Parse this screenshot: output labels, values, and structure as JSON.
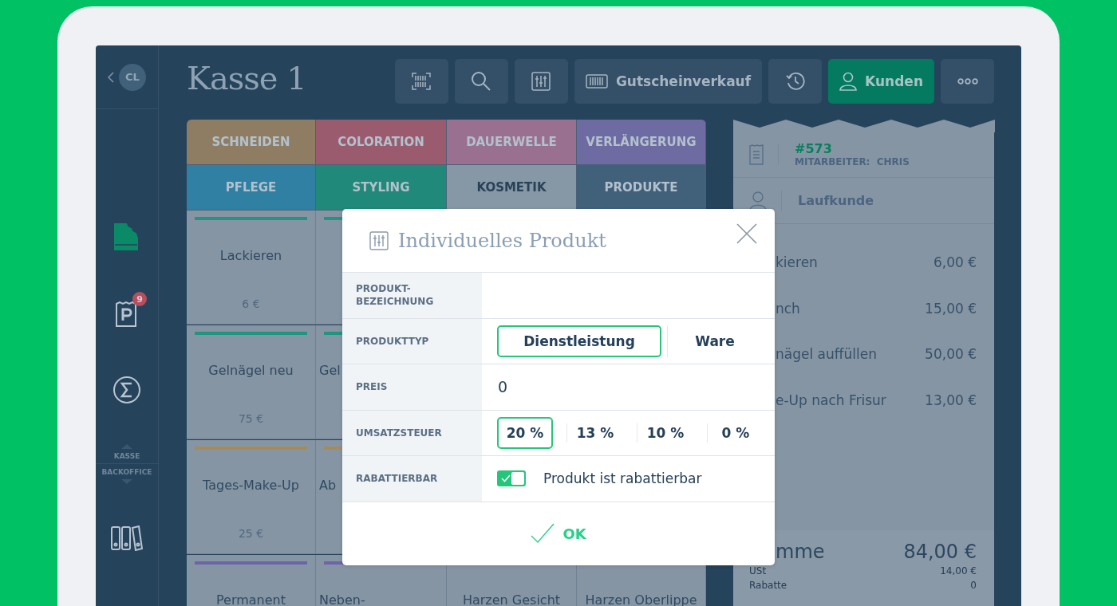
{
  "sidebar": {
    "avatar": "CL",
    "items": [
      {
        "kind": "register",
        "selected": true
      },
      {
        "kind": "parking",
        "badge": "9",
        "selected": false
      },
      {
        "kind": "sum",
        "selected": false
      }
    ],
    "mode_switch": {
      "upper": "KASSE",
      "lower": "BACKOFFICE"
    },
    "bottom_items": [
      {
        "kind": "binders",
        "selected": false
      }
    ]
  },
  "header": {
    "title": "Kasse 1"
  },
  "toolbar": [
    {
      "kind": "scan",
      "selected": false
    },
    {
      "kind": "search",
      "selected": false
    },
    {
      "kind": "custom",
      "selected": false
    },
    {
      "kind": "voucher",
      "label": "Gutscheinverkauf",
      "selected": false
    },
    {
      "kind": "history",
      "selected": false
    },
    {
      "kind": "customer",
      "label": "Kunden",
      "selected": true
    },
    {
      "kind": "more",
      "selected": false
    }
  ],
  "categories": [
    {
      "label": "SCHNEIDEN",
      "color": "#8e7d62",
      "selected": false
    },
    {
      "label": "COLORATION",
      "color": "#9a5b6e",
      "selected": false
    },
    {
      "label": "DAUERWELLE",
      "color": "#9a7090",
      "selected": false
    },
    {
      "label": "VERLÄNGERUNG",
      "color": "#6e6aa2",
      "selected": false
    },
    {
      "label": "PFLEGE",
      "color": "#2f80a2",
      "selected": false
    },
    {
      "label": "STYLING",
      "color": "#21897a",
      "selected": false
    },
    {
      "label": "KOSMETIK",
      "color": "#8697a6",
      "selected": true
    },
    {
      "label": "PRODUKTE",
      "color": "#41607a",
      "selected": false
    }
  ],
  "product_rows": [
    {
      "cells": [
        {
          "name": "Lackieren",
          "price": "6 €",
          "color": "#21957f"
        },
        {
          "color": "#21957f"
        }
      ]
    },
    {
      "cells": [
        {
          "name": "Gelnägel neu",
          "price": "75 €",
          "color": "#21957f"
        },
        {
          "name": "Gel",
          "color": "#21957f"
        }
      ]
    },
    {
      "cells": [
        {
          "name": "Tages-Make-Up",
          "price": "25 €",
          "color": "#a88a5a"
        },
        {
          "name": "Ab",
          "color": "#a88a5a"
        }
      ]
    },
    {
      "cells": [
        {
          "name": "Permanent",
          "color": "#6d65a8"
        },
        {
          "name": "Neben-",
          "color": "#6d65a8"
        },
        {
          "name": "Harzen Gesicht"
        },
        {
          "name": "Harzen Oberlippe"
        }
      ]
    }
  ],
  "receipt": {
    "number": "#573",
    "staff": "MITARBEITER:  CHRIS",
    "customer": "Laufkunde",
    "items": [
      {
        "name": "kieren",
        "price": "6,00 €"
      },
      {
        "name": "nch",
        "price": "15,00 €"
      },
      {
        "name": "nägel auffüllen",
        "price": "50,00 €"
      },
      {
        "name": "e-Up nach Frisur",
        "price": "13,00 €"
      }
    ],
    "total_label": "mme",
    "total": "84,00 €",
    "tax_label": "USt",
    "tax": "14,00 €",
    "discount_label": "Rabatte",
    "discount": "0"
  },
  "dialog": {
    "title": "Individuelles Produkt",
    "name_label": "PRODUKT-\nBEZEICHNUNG",
    "type_label": "PRODUKTTYP",
    "types": [
      {
        "label": "Dienstleistung",
        "selected": true
      },
      {
        "label": "Ware",
        "selected": false
      }
    ],
    "price_label": "PREIS",
    "price": "0",
    "tax_label": "UMSATZSTEUER",
    "taxes": [
      {
        "label": "20 %",
        "selected": true
      },
      {
        "label": "13 %",
        "selected": false
      },
      {
        "label": "10 %",
        "selected": false
      },
      {
        "label": "0 %",
        "selected": false
      }
    ],
    "discount_label": "RABATTIERBAR",
    "discountable": {
      "checked": true,
      "label": "Produkt ist rabattierbar"
    },
    "ok": "OK"
  }
}
